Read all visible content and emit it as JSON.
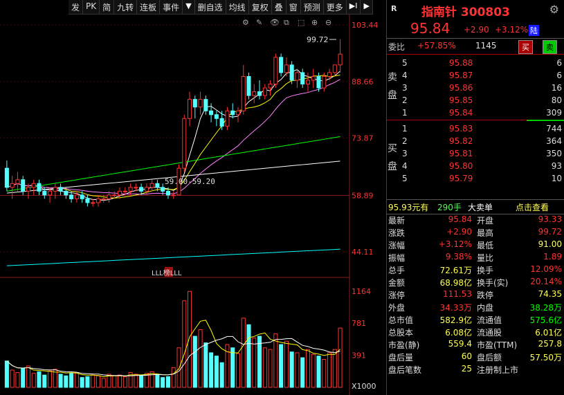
{
  "toolbar": {
    "items": [
      "发",
      "PK",
      "简",
      "九转",
      "连板",
      "事件",
      "▼",
      "删自选",
      "均线",
      "复权",
      "叠",
      "窗",
      "预测",
      "更多",
      "▶I",
      "▶"
    ]
  },
  "chart": {
    "price_axis": [
      "103.44",
      "88.66",
      "73.87",
      "58.89",
      "44.11"
    ],
    "volume_axis": [
      "1164",
      "781",
      "391",
      "X1000"
    ],
    "high_label": "99.72",
    "range_label": "59.00-59.20",
    "event_label": "LLL榜LLL",
    "colors": {
      "up": "#ff3232",
      "down": "#54ffff",
      "ma5": "#ffffff",
      "ma10": "#ffff00",
      "ma20": "#ff80ff",
      "ma60": "#00ff00",
      "ma120": "#ffffff",
      "ma250": "#00ffff"
    }
  },
  "chart_data": {
    "type": "candlestick",
    "ylim": [
      38,
      106
    ],
    "candles": [
      [
        66,
        68,
        60,
        61
      ],
      [
        61,
        64,
        58,
        62
      ],
      [
        62,
        65,
        60,
        63
      ],
      [
        63,
        64,
        59,
        60
      ],
      [
        60,
        62,
        58,
        61
      ],
      [
        61,
        63,
        59,
        62
      ],
      [
        62,
        63,
        59,
        60
      ],
      [
        60,
        61,
        58,
        59
      ],
      [
        59,
        61,
        57,
        60
      ],
      [
        60,
        62,
        58,
        61
      ],
      [
        61,
        62,
        59,
        60
      ],
      [
        60,
        61,
        58,
        59
      ],
      [
        59,
        60,
        57,
        58
      ],
      [
        58,
        60,
        57,
        59
      ],
      [
        59,
        60,
        57,
        58
      ],
      [
        58,
        59,
        56,
        57
      ],
      [
        57,
        58,
        56,
        57
      ],
      [
        57,
        59,
        56,
        58
      ],
      [
        58,
        59,
        57,
        58
      ],
      [
        58,
        60,
        57,
        59
      ],
      [
        59,
        60,
        58,
        59
      ],
      [
        59,
        61,
        58,
        60
      ],
      [
        60,
        61,
        59,
        60
      ],
      [
        60,
        62,
        59,
        61
      ],
      [
        61,
        62,
        60,
        61
      ],
      [
        61,
        62,
        59,
        60
      ],
      [
        60,
        62,
        59,
        61
      ],
      [
        61,
        63,
        60,
        62
      ],
      [
        62,
        63,
        60,
        61
      ],
      [
        61,
        62,
        59,
        60
      ],
      [
        60,
        61,
        58,
        59
      ],
      [
        59,
        60,
        58,
        59
      ],
      [
        59,
        67,
        59,
        66
      ],
      [
        66,
        80,
        65,
        79
      ],
      [
        79,
        86,
        77,
        84
      ],
      [
        84,
        85,
        79,
        82
      ],
      [
        82,
        86,
        80,
        84
      ],
      [
        84,
        85,
        80,
        81
      ],
      [
        81,
        83,
        78,
        80
      ],
      [
        80,
        81,
        77,
        79
      ],
      [
        79,
        81,
        76,
        77
      ],
      [
        77,
        82,
        76,
        81
      ],
      [
        81,
        83,
        79,
        80
      ],
      [
        80,
        82,
        78,
        81
      ],
      [
        81,
        93,
        80,
        90
      ],
      [
        90,
        91,
        84,
        85
      ],
      [
        85,
        88,
        83,
        86
      ],
      [
        86,
        89,
        84,
        85
      ],
      [
        85,
        88,
        84,
        87
      ],
      [
        87,
        89,
        85,
        88
      ],
      [
        88,
        96,
        87,
        95
      ],
      [
        95,
        96,
        90,
        91
      ],
      [
        91,
        95,
        90,
        93
      ],
      [
        93,
        94,
        88,
        89
      ],
      [
        89,
        92,
        87,
        91
      ],
      [
        91,
        92,
        87,
        88
      ],
      [
        88,
        91,
        86,
        89
      ],
      [
        89,
        92,
        87,
        90
      ],
      [
        90,
        91,
        86,
        87
      ],
      [
        87,
        91,
        86,
        90
      ],
      [
        90,
        92,
        89,
        91
      ],
      [
        91,
        93,
        90,
        93
      ],
      [
        93,
        99.72,
        91,
        95.84
      ]
    ],
    "volume": [
      320,
      210,
      180,
      230,
      260,
      170,
      190,
      150,
      200,
      220,
      160,
      140,
      170,
      180,
      120,
      130,
      150,
      140,
      110,
      160,
      140,
      150,
      130,
      180,
      160,
      140,
      170,
      190,
      150,
      120,
      130,
      240,
      480,
      1050,
      1164,
      620,
      700,
      540,
      420,
      380,
      300,
      520,
      480,
      410,
      840,
      760,
      600,
      620,
      480,
      460,
      650,
      520,
      560,
      430,
      420,
      360,
      460,
      400,
      380,
      340,
      420,
      460,
      720
    ],
    "ylim_volume": [
      0,
      1300
    ]
  },
  "quote": {
    "r": "R",
    "name": "指南针 300803",
    "price": "95.84",
    "change": "+2.90",
    "pct": "+3.12%",
    "exchange_badge": "陆"
  },
  "weibi": {
    "label": "委比",
    "value": "+57.85%",
    "num": "1145",
    "buy": "买",
    "sell": "卖"
  },
  "asks": [
    {
      "i": "5",
      "p": "95.88",
      "q": "6"
    },
    {
      "i": "4",
      "p": "95.87",
      "q": "6"
    },
    {
      "i": "3",
      "p": "95.86",
      "q": "16"
    },
    {
      "i": "2",
      "p": "95.85",
      "q": "80"
    },
    {
      "i": "1",
      "p": "95.84",
      "q": "309"
    }
  ],
  "bids": [
    {
      "i": "1",
      "p": "95.83",
      "q": "744"
    },
    {
      "i": "2",
      "p": "95.82",
      "q": "364"
    },
    {
      "i": "3",
      "p": "95.81",
      "q": "350"
    },
    {
      "i": "4",
      "p": "95.80",
      "q": "93"
    },
    {
      "i": "5",
      "p": "95.79",
      "q": "10"
    }
  ],
  "ask_side": [
    "卖",
    "盘"
  ],
  "bid_side": [
    "买",
    "盘"
  ],
  "bigorder": {
    "price": "95.93元有",
    "vol": "290手",
    "label": "大卖单",
    "link": "点击查看"
  },
  "stats": [
    {
      "k": "最新",
      "v": "95.84",
      "k2": "开盘",
      "v2": "93.33"
    },
    {
      "k": "涨跌",
      "v": "+2.90",
      "k2": "最高",
      "v2": "99.72"
    },
    {
      "k": "涨幅",
      "v": "+3.12%",
      "k2": "最低",
      "v2": "91.00"
    },
    {
      "k": "振幅",
      "v": "9.38%",
      "k2": "量比",
      "v2": "1.89"
    },
    {
      "k": "总手",
      "v": "72.61万",
      "k2": "换手",
      "v2": "12.09%"
    },
    {
      "k": "金额",
      "v": "68.98亿",
      "k2": "换手(实)",
      "v2": "20.14%"
    },
    {
      "k": "涨停",
      "v": "111.53",
      "k2": "跌停",
      "v2": "74.35"
    },
    {
      "k": "外盘",
      "v": "34.33万",
      "k2": "内盘",
      "v2": "38.28万"
    },
    {
      "k": "总市值",
      "v": "582.9亿",
      "k2": "流通值",
      "v2": "575.6亿"
    },
    {
      "k": "总股本",
      "v": "6.08亿",
      "k2": "流通股",
      "v2": "6.01亿"
    },
    {
      "k": "市盈(静)",
      "v": "559.4",
      "k2": "市盈(TTM)",
      "v2": "257.8"
    },
    {
      "k": "盘后量",
      "v": "60",
      "k2": "盘后额",
      "v2": "57.50万"
    },
    {
      "k": "盘后笔数",
      "v": "25",
      "k2": "注册制上市",
      "v2": ""
    }
  ]
}
